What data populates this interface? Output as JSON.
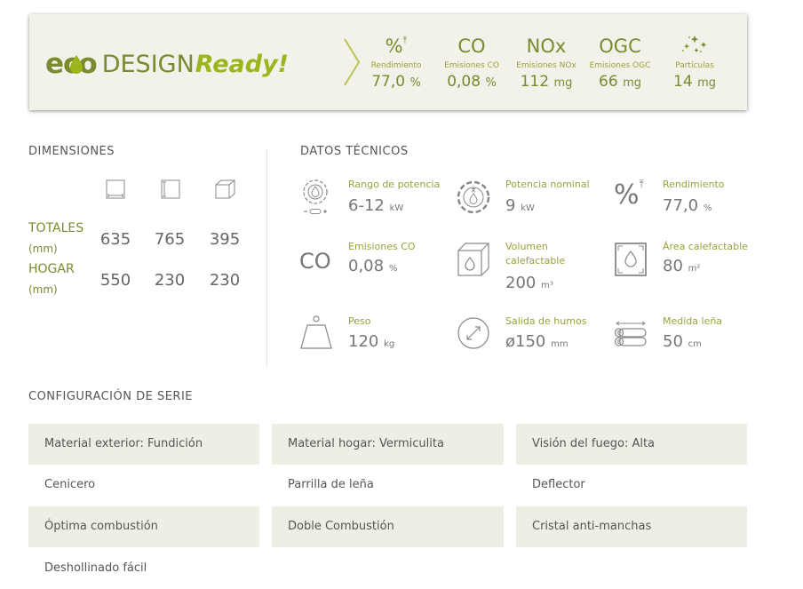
{
  "ecodesign": {
    "logo_eco": "eco",
    "logo_design": "DESIGN",
    "logo_ready": "Ready!",
    "metrics": [
      {
        "symbol": "%",
        "icon": "percent-arrow-icon",
        "label": "Rendimiento",
        "value": "77,0",
        "unit": "%"
      },
      {
        "symbol": "CO",
        "label": "Emisiones CO",
        "value": "0,08",
        "unit": "%"
      },
      {
        "symbol": "NOx",
        "label": "Emisiones NOx",
        "value": "112",
        "unit": "mg"
      },
      {
        "symbol": "OGC",
        "label": "Emisiones OGC",
        "value": "66",
        "unit": "mg"
      },
      {
        "symbol": "",
        "icon": "particles-icon",
        "label": "Partículas",
        "value": "14",
        "unit": "mg"
      }
    ]
  },
  "dimensions": {
    "title": "DIMENSIONES",
    "column_icons": [
      "width-icon",
      "height-icon",
      "depth-icon"
    ],
    "rows": [
      {
        "label": "TOTALES",
        "unit": "(mm)",
        "values": [
          "635",
          "765",
          "395"
        ]
      },
      {
        "label": "HOGAR",
        "unit": "(mm)",
        "values": [
          "550",
          "230",
          "230"
        ]
      }
    ]
  },
  "tech": {
    "title": "DATOS TÉCNICOS",
    "items": [
      {
        "icon": "power-range-icon",
        "label": "Rango de potencia",
        "value": "6-12",
        "unit": "kW"
      },
      {
        "icon": "nominal-power-icon",
        "label": "Potencia nominal",
        "value": "9",
        "unit": "kW"
      },
      {
        "icon": "efficiency-icon",
        "label": "Rendimiento",
        "value": "77,0",
        "unit": "%"
      },
      {
        "icon": "co-icon",
        "symbol": "CO",
        "label": "Emisiones CO",
        "value": "0,08",
        "unit": "%"
      },
      {
        "icon": "heated-volume-icon",
        "label": "Volumen",
        "label2": "calefactable",
        "value": "200",
        "unit": "m³"
      },
      {
        "icon": "heated-area-icon",
        "label": "Área calefactable",
        "value": "80",
        "unit": "m²"
      },
      {
        "icon": "weight-icon",
        "label": "Peso",
        "value": "120",
        "unit": "kg"
      },
      {
        "icon": "flue-outlet-icon",
        "label": "Salida de humos",
        "value": "ø150",
        "unit": "mm"
      },
      {
        "icon": "log-size-icon",
        "label": "Medida leña",
        "value": "50",
        "unit": "cm"
      }
    ]
  },
  "config": {
    "title": "CONFIGURACIÓN DE SERIE",
    "rows": [
      [
        "Material exterior: Fundición",
        "Material hogar: Vermiculita",
        "Visión del fuego: Alta"
      ],
      [
        "Cenicero",
        "Parrilla de leña",
        "Deflector"
      ],
      [
        "Óptima combustión",
        "Doble Combustión",
        "Cristal anti-manchas"
      ],
      [
        "Deshollinado fácil",
        "",
        ""
      ]
    ]
  },
  "colors": {
    "brand_green": "#7a8a2e",
    "accent_green": "#9db51c",
    "banner_bg": "#f2f2ea",
    "shade": "#eeeee5"
  }
}
